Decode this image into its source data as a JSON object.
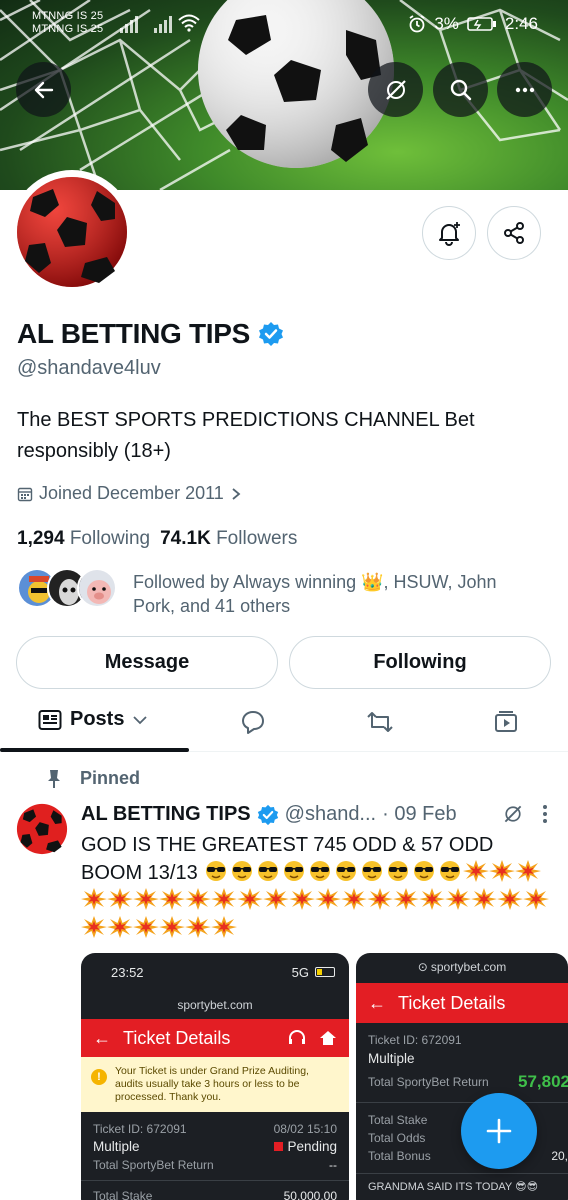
{
  "status_bar": {
    "carrier1": "MTNNG IS 25",
    "carrier2": "MTNNG IS 25",
    "battery": "3%",
    "time": "2:46"
  },
  "profile": {
    "name": "AL BETTING TIPS",
    "handle": "@shandave4luv",
    "bio": "The BEST SPORTS PREDICTIONS CHANNEL Bet responsibly (18+)",
    "joined": "Joined December 2011",
    "following_count": "1,294",
    "following_label": "Following",
    "followers_count": "74.1K",
    "followers_label": "Followers",
    "followed_by": "Followed by Always winning 👑, HSUW, John Pork, and 41 others"
  },
  "actions": {
    "message": "Message",
    "following": "Following"
  },
  "tabs": {
    "posts": "Posts"
  },
  "post": {
    "pinned_label": "Pinned",
    "author": "AL BETTING TIPS",
    "handle": "@shand...",
    "date": "· 09 Feb",
    "text": "GOD IS THE GREATEST 745 ODD & 57 ODD BOOM 13/13"
  },
  "screenshot1": {
    "time": "23:52",
    "network": "5G",
    "url": "sportybet.com",
    "header": "Ticket Details",
    "notice": "Your Ticket is under Grand Prize Auditing, audits usually take 3 hours or less to be processed. Thank you.",
    "ticket_id": "Ticket ID: 672091",
    "date": "08/02 15:10",
    "type": "Multiple",
    "status": "Pending",
    "return_label": "Total SportyBet Return",
    "return_value": "--",
    "stake_label": "Total Stake",
    "stake_value": "50,000.00"
  },
  "screenshot2": {
    "url": "sportybet.com",
    "header": "Ticket Details",
    "ticket_id": "Ticket ID: 672091",
    "type": "Multiple",
    "return_label": "Total SportyBet Return",
    "return_value": "57,802",
    "stake_label": "Total Stake",
    "odds_label": "Total Odds",
    "bonus_label": "Total Bonus",
    "bonus_value": "20,",
    "footer": "GRANDMA SAID ITS TODAY 😎😎"
  }
}
